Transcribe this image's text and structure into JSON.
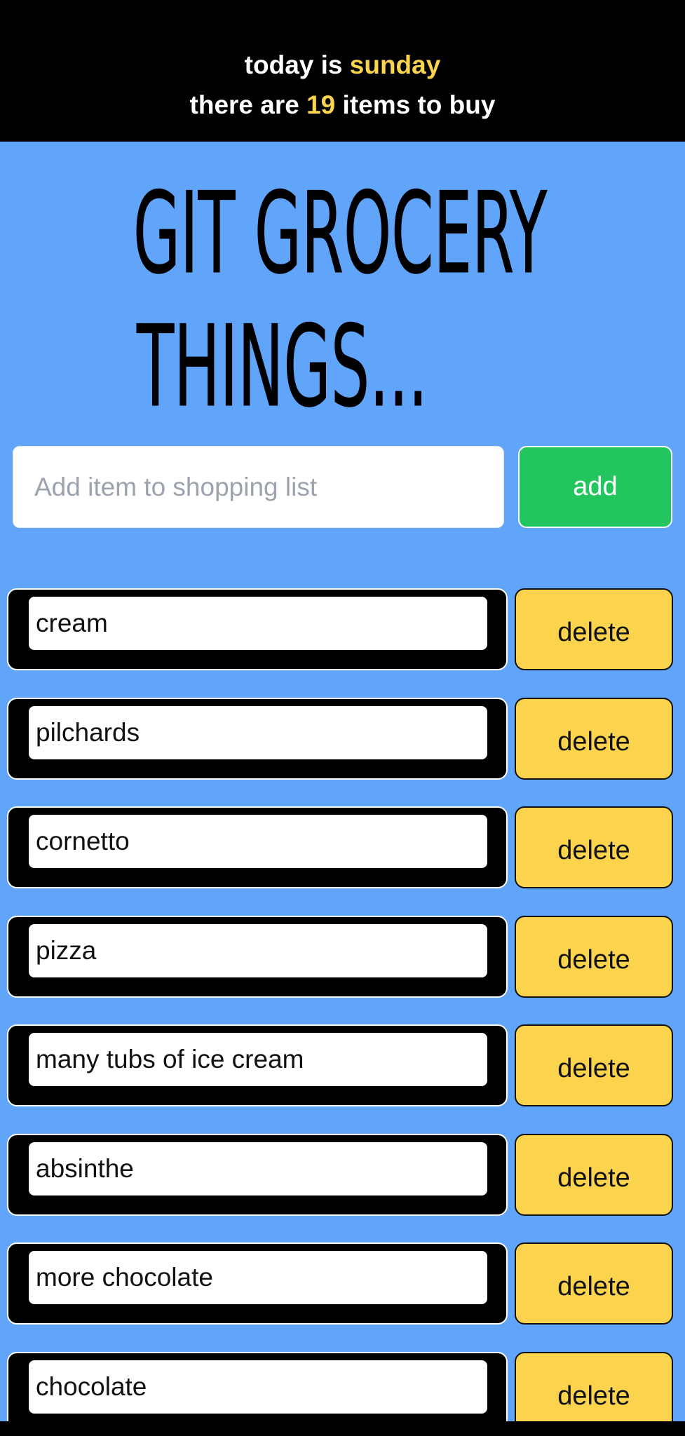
{
  "header": {
    "day_prefix": "today is ",
    "day": "sunday",
    "count_prefix": "there are ",
    "count": "19",
    "count_suffix": " items to buy"
  },
  "title": {
    "line1": "GIT GROCERY",
    "line2": "THINGS..."
  },
  "add_form": {
    "placeholder": "Add item to shopping list",
    "value": "",
    "button_label": "add"
  },
  "items": [
    {
      "name": "cream",
      "delete_label": "delete"
    },
    {
      "name": "pilchards",
      "delete_label": "delete"
    },
    {
      "name": "cornetto",
      "delete_label": "delete"
    },
    {
      "name": "pizza",
      "delete_label": "delete"
    },
    {
      "name": "many tubs of ice cream",
      "delete_label": "delete"
    },
    {
      "name": "absinthe",
      "delete_label": "delete"
    },
    {
      "name": "more chocolate",
      "delete_label": "delete"
    },
    {
      "name": "chocolate",
      "delete_label": "delete"
    }
  ],
  "colors": {
    "page_background": "#60a5fa",
    "header_background": "#000000",
    "highlight": "#fcd34d",
    "add_button": "#22c55e",
    "delete_button": "#fcd34d"
  }
}
